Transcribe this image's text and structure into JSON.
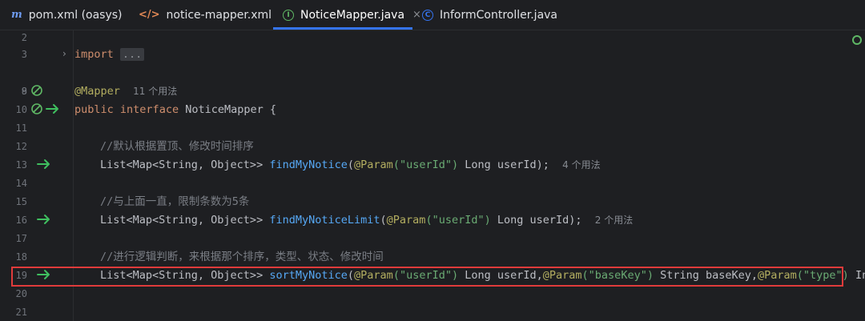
{
  "tabs": [
    {
      "icon": "m",
      "label": "pom.xml (oasys)",
      "active": false
    },
    {
      "icon": "</>",
      "label": "notice-mapper.xml",
      "active": false
    },
    {
      "icon": "I",
      "label": "NoticeMapper.java",
      "active": true,
      "close": "×"
    },
    {
      "icon": "C",
      "label": "InformController.java",
      "active": false
    }
  ],
  "lines": [
    {
      "n": "2"
    },
    {
      "n": "3",
      "import_kw": "import",
      "fold": "..."
    },
    {
      "n": "8"
    },
    {
      "n": "9",
      "annotation": "@Mapper",
      "hint": "11 个用法"
    },
    {
      "n": "10",
      "kw1": "public",
      "kw2": "interface",
      "name": "NoticeMapper",
      "brace": "{"
    },
    {
      "n": "11"
    },
    {
      "n": "12",
      "comment": "//默认根据置顶、修改时间排序"
    },
    {
      "n": "13",
      "ret": "List<Map<String, Object>>",
      "method": "findMyNotice",
      "open": "(",
      "param_ann": "@Param",
      "param_str": "(\"userId\")",
      "rest": " Long userId);",
      "hint": "4 个用法"
    },
    {
      "n": "14"
    },
    {
      "n": "15",
      "comment": "//与上面一直，限制条数为5条"
    },
    {
      "n": "16",
      "ret": "List<Map<String, Object>>",
      "method": "findMyNoticeLimit",
      "open": "(",
      "param_ann": "@Param",
      "param_str": "(\"userId\")",
      "rest": " Long userId);",
      "hint": "2 个用法"
    },
    {
      "n": "17"
    },
    {
      "n": "18",
      "comment": "//进行逻辑判断，来根据那个排序，类型、状态、修改时间"
    },
    {
      "n": "19",
      "ret": "List<Map<String, Object>>",
      "method": "sortMyNotice",
      "open": "(",
      "p1_ann": "@Param",
      "p1_str": "(\"userId\")",
      "p1_rest": " Long userId,",
      "p2_ann": "@Param",
      "p2_str": "(\"baseKey\")",
      "p2_rest": " String baseKey,",
      "p3_ann": "@Param",
      "p3_str": "(\"type\")",
      "p3_rest": " Int"
    },
    {
      "n": "20"
    },
    {
      "n": "21"
    }
  ]
}
